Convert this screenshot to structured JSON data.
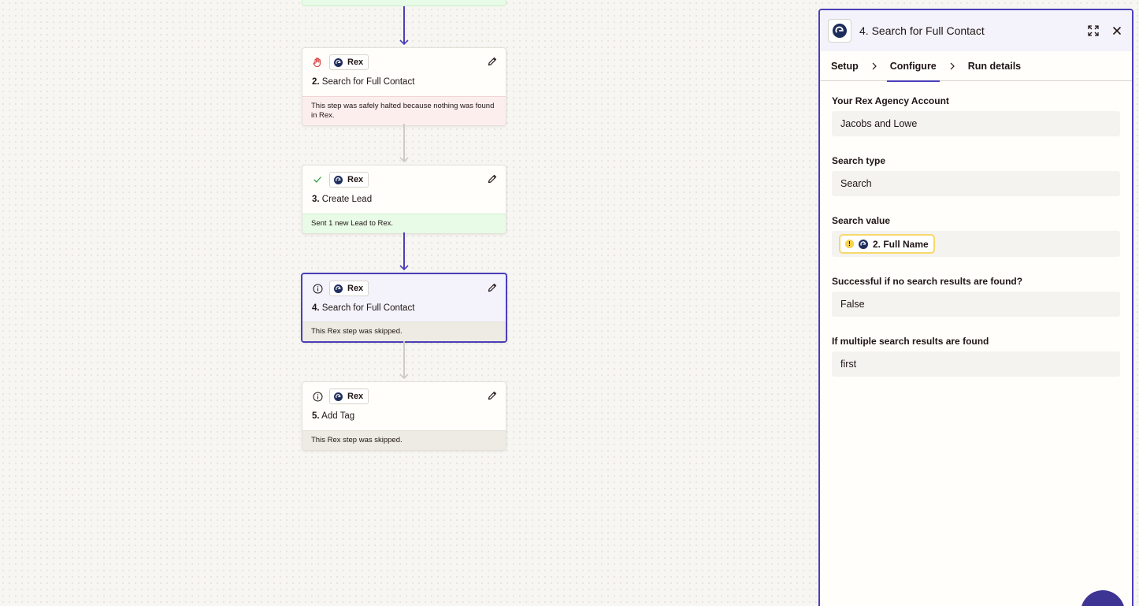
{
  "steps": [
    {
      "status": "halted",
      "app": "Rex",
      "number": "2.",
      "title": "Search for Full Contact",
      "message": "This step was safely halted because nothing was found in Rex."
    },
    {
      "status": "success",
      "app": "Rex",
      "number": "3.",
      "title": "Create Lead",
      "message": "Sent 1 new Lead to Rex."
    },
    {
      "status": "skipped",
      "app": "Rex",
      "number": "4.",
      "title": "Search for Full Contact",
      "message": "This Rex step was skipped.",
      "selected": true
    },
    {
      "status": "skipped",
      "app": "Rex",
      "number": "5.",
      "title": "Add Tag",
      "message": "This Rex step was skipped."
    }
  ],
  "panel": {
    "title": "4. Search for Full Contact",
    "tabs": [
      {
        "label": "Setup",
        "active": false
      },
      {
        "label": "Configure",
        "active": true
      },
      {
        "label": "Run details",
        "active": false
      }
    ],
    "fields": [
      {
        "label": "Your Rex Agency Account",
        "value": "Jacobs and Lowe"
      },
      {
        "label": "Search type",
        "value": "Search"
      },
      {
        "label": "Search value",
        "pill": "2. Full Name"
      },
      {
        "label": "Successful if no search results are found?",
        "value": "False"
      },
      {
        "label": "If multiple search results are found",
        "value": "first"
      }
    ]
  },
  "colors": {
    "accent": "#4b3fb8",
    "halted": "#d63a3a",
    "success": "#2f9e44",
    "warning": "#f6d24a"
  },
  "icons": {
    "halted": "hand-stop-icon",
    "success": "check-icon",
    "skipped": "info-circle-icon",
    "edit": "pencil-icon",
    "expand": "expand-icon",
    "close": "close-icon",
    "tab_separator": "chevron-right-icon",
    "app": "rex-logo-icon"
  }
}
